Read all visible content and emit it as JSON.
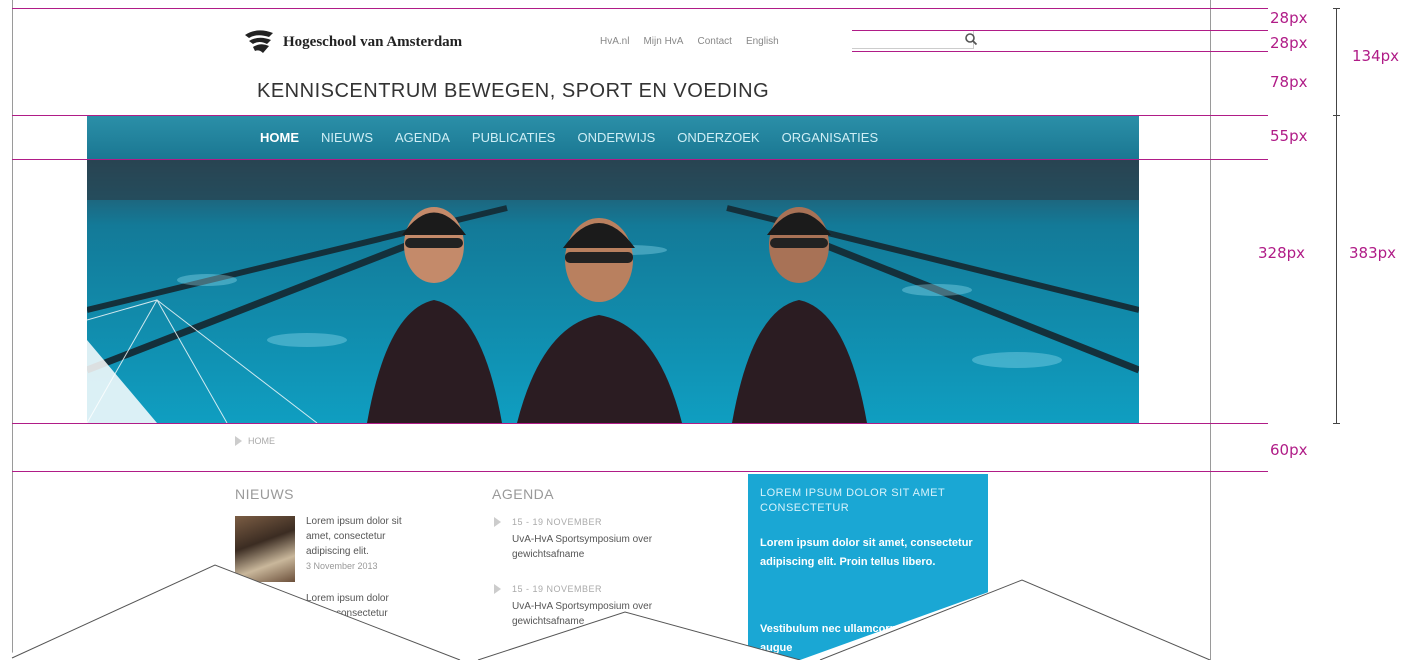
{
  "header": {
    "logo_text": "Hogeschool van Amsterdam",
    "top_links": [
      "HvA.nl",
      "Mijn HvA",
      "Contact",
      "English"
    ],
    "site_title": "KENNISCENTRUM BEWEGEN, SPORT EN VOEDING"
  },
  "nav": {
    "items": [
      "HOME",
      "NIEUWS",
      "AGENDA",
      "PUBLICATIES",
      "ONDERWIJS",
      "ONDERZOEK",
      "ORGANISATIES"
    ],
    "active": "HOME"
  },
  "breadcrumb": {
    "label": "HOME"
  },
  "news": {
    "heading": "NIEUWS",
    "item1": {
      "line1": "Lorem ipsum dolor sit",
      "line2": "amet, consectetur",
      "line3": "adipiscing elit.",
      "date": "3 November 2013"
    },
    "item2": {
      "line1": "Lorem ipsum dolor",
      "line2": "consectetur"
    }
  },
  "agenda": {
    "heading": "AGENDA",
    "items": [
      {
        "date": "15 - 19 NOVEMBER",
        "line1": "UvA-HvA Sportsymposium over",
        "line2": "gewichtsafname"
      },
      {
        "date": "15 - 19 NOVEMBER",
        "line1": "UvA-HvA Sportsymposium over",
        "line2": "gewichtsafname"
      }
    ]
  },
  "promo": {
    "heading": "LOREM IPSUM DOLOR SIT AMET CONSECTETUR",
    "body": "Lorem ipsum dolor sit amet, consectetur adipiscing elit. Proin tellus libero.",
    "body2": "Vestibulum nec ullamcorper egestas vel augue"
  },
  "measures": {
    "m1": "28px",
    "m2": "28px",
    "m3": "78px",
    "m_total_header": "134px",
    "m4": "55px",
    "m5": "328px",
    "m_total_hero": "383px",
    "m6": "60px"
  },
  "colors": {
    "annotation": "#b01c87",
    "nav_bg": "#1f84a0",
    "promo_bg": "#1aa7d4"
  }
}
